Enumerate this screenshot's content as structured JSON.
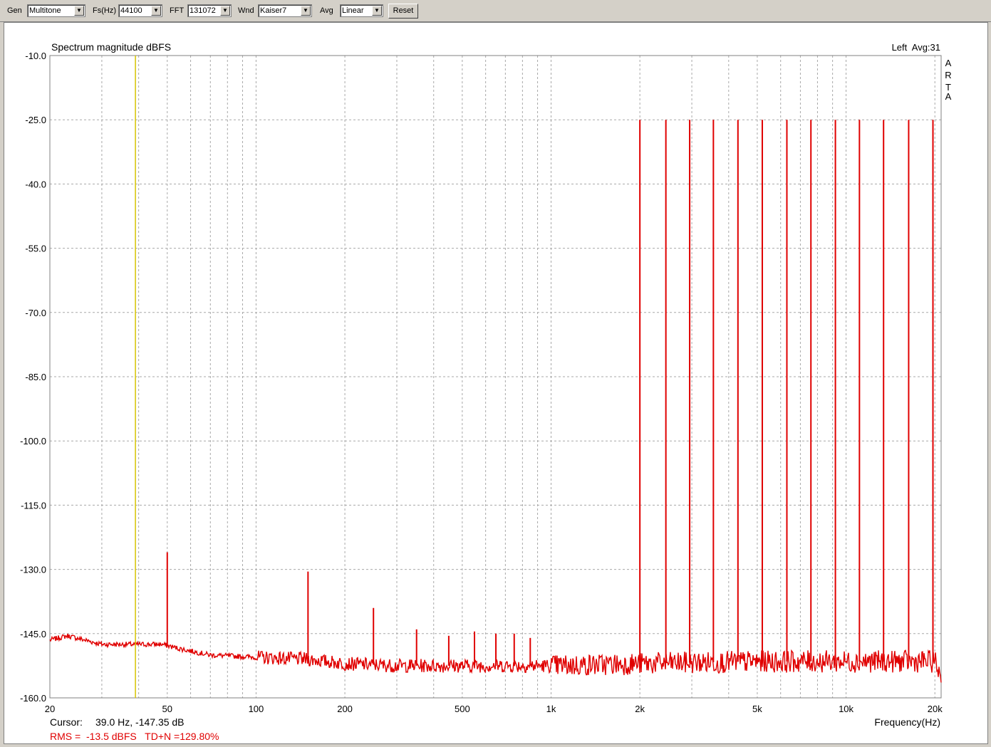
{
  "toolbar": {
    "gen_label": "Gen",
    "gen_value": "Multitone",
    "fs_label": "Fs(Hz)",
    "fs_value": "44100",
    "fft_label": "FFT",
    "fft_value": "131072",
    "wnd_label": "Wnd",
    "wnd_value": "Kaiser7",
    "avg_label": "Avg",
    "avg_value": "Linear",
    "reset_label": "Reset"
  },
  "chart": {
    "title": "Spectrum magnitude dBFS",
    "channel_info": "Left  Avg:31",
    "brand_letters": [
      "A",
      "R",
      "T",
      "A"
    ],
    "xlabel": "Frequency(Hz)",
    "cursor_label": "Cursor:",
    "cursor_value": "39.0 Hz, -147.35 dB",
    "rms_text": "RMS =  -13.5 dBFS   TD+N =129.80%"
  },
  "chart_data": {
    "type": "line",
    "title": "Spectrum magnitude dBFS",
    "xlabel": "Frequency(Hz)",
    "ylabel": "",
    "x_scale": "log",
    "xlim": [
      20,
      21000
    ],
    "ylim": [
      -160,
      -10
    ],
    "grid": true,
    "y_ticks": [
      "-10.0",
      "-25.0",
      "-40.0",
      "-55.0",
      "-70.0",
      "-85.0",
      "-100.0",
      "-115.0",
      "-130.0",
      "-145.0",
      "-160.0"
    ],
    "x_ticks": [
      {
        "value": 20,
        "label": "20"
      },
      {
        "value": 50,
        "label": "50"
      },
      {
        "value": 100,
        "label": "100"
      },
      {
        "value": 200,
        "label": "200"
      },
      {
        "value": 500,
        "label": "500"
      },
      {
        "value": 1000,
        "label": "1k"
      },
      {
        "value": 2000,
        "label": "2k"
      },
      {
        "value": 5000,
        "label": "5k"
      },
      {
        "value": 10000,
        "label": "10k"
      },
      {
        "value": 20000,
        "label": "20k"
      }
    ],
    "cursor": {
      "x": 39.0,
      "y": -147.35
    },
    "series": [
      {
        "color": "#e00000",
        "noise_floor": [
          [
            20,
            -146.5
          ],
          [
            23,
            -145.5
          ],
          [
            30,
            -147.5
          ],
          [
            40,
            -147.5
          ],
          [
            48,
            -147.5
          ],
          [
            55,
            -148.5
          ],
          [
            70,
            -150.0
          ],
          [
            100,
            -150.5
          ],
          [
            150,
            -151.0
          ],
          [
            200,
            -152.0
          ],
          [
            300,
            -152.5
          ],
          [
            500,
            -152.5
          ],
          [
            1000,
            -152.5
          ],
          [
            2000,
            -152.0
          ],
          [
            5000,
            -151.5
          ],
          [
            10000,
            -151.5
          ],
          [
            20000,
            -151.5
          ],
          [
            21000,
            -155.0
          ]
        ],
        "peaks": [
          {
            "f": 50,
            "db": -126.0
          },
          {
            "f": 150,
            "db": -130.5
          },
          {
            "f": 250,
            "db": -139.0
          },
          {
            "f": 350,
            "db": -144.0
          },
          {
            "f": 450,
            "db": -145.5
          },
          {
            "f": 550,
            "db": -144.5
          },
          {
            "f": 650,
            "db": -145.0
          },
          {
            "f": 750,
            "db": -145.0
          },
          {
            "f": 850,
            "db": -146.0
          },
          {
            "f": 2000,
            "db": -25.0
          },
          {
            "f": 2450,
            "db": -25.0
          },
          {
            "f": 2950,
            "db": -25.0
          },
          {
            "f": 3550,
            "db": -25.0
          },
          {
            "f": 4300,
            "db": -25.0
          },
          {
            "f": 5200,
            "db": -25.0
          },
          {
            "f": 6300,
            "db": -25.0
          },
          {
            "f": 7600,
            "db": -25.0
          },
          {
            "f": 9200,
            "db": -25.0
          },
          {
            "f": 11100,
            "db": -25.0
          },
          {
            "f": 13400,
            "db": -25.0
          },
          {
            "f": 16300,
            "db": -25.0
          },
          {
            "f": 19700,
            "db": -25.0
          }
        ]
      }
    ]
  }
}
